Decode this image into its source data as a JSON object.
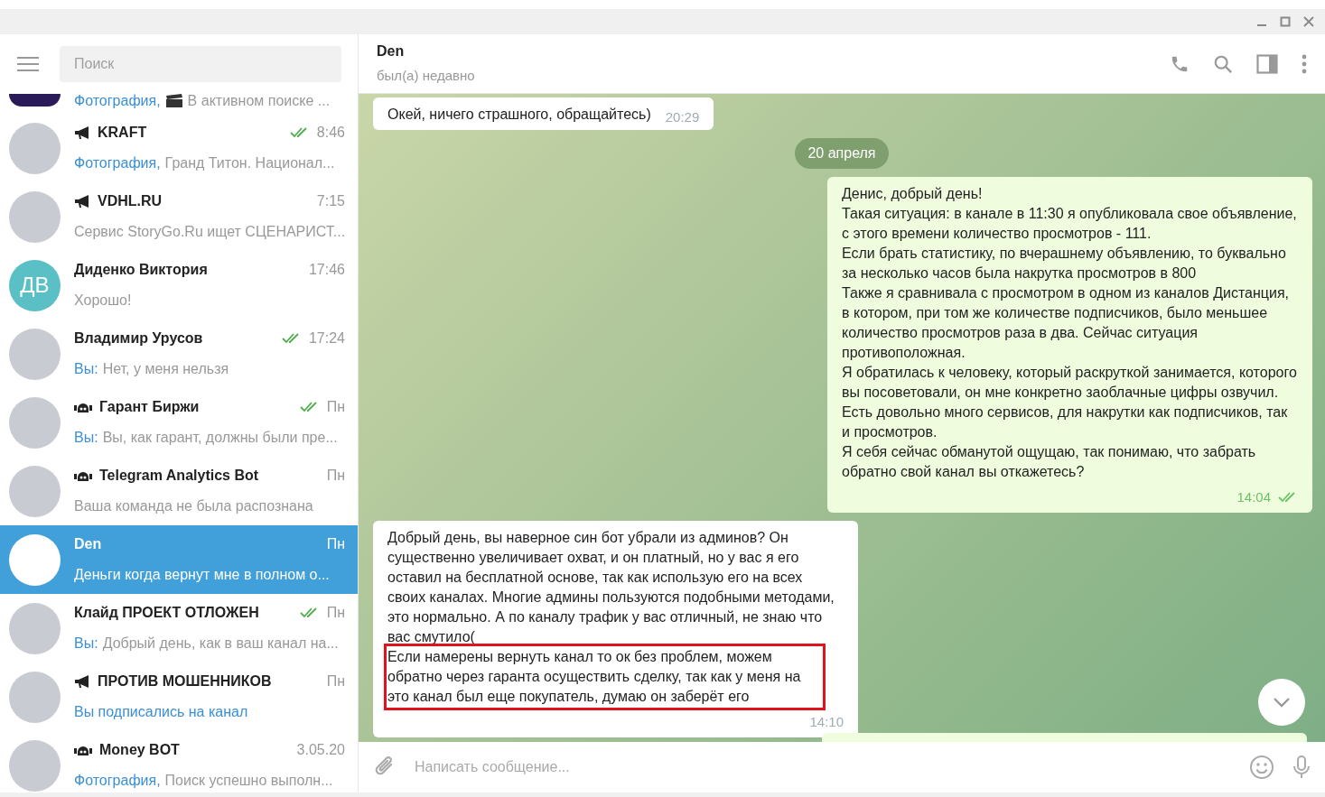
{
  "sidebar": {
    "search": {
      "placeholder": "Поиск"
    },
    "chats": [
      {
        "kind": "partial",
        "read": false,
        "highlight": "Фотография,",
        "video_icon": true,
        "preview": "В активном поиске ...",
        "selected": false
      },
      {
        "name": "KRAFT",
        "kind": "channel",
        "time": "8:46",
        "read": true,
        "highlight": "Фотография,",
        "video_icon": false,
        "preview": "Гранд Титон. Национал...",
        "selected": false
      },
      {
        "name": "VDHL.RU",
        "kind": "channel",
        "time": "7:15",
        "read": false,
        "video_icon": false,
        "preview": "Сервис StoryGo.Ru ищет СЦЕНАРИСТ...",
        "selected": false
      },
      {
        "name": "Диденко Виктория",
        "kind": "user",
        "avatar": {
          "initials": "ДВ",
          "color": "#5ac0c5"
        },
        "time": "17:46",
        "read": false,
        "video_icon": false,
        "preview": "Хорошо!",
        "selected": false
      },
      {
        "name": "Владимир Урусов",
        "kind": "user",
        "time": "17:24",
        "read": true,
        "sender": "Вы:",
        "video_icon": false,
        "preview": "Нет, у меня нельзя",
        "selected": false
      },
      {
        "name": "Гарант Биржи",
        "kind": "bot",
        "time": "Пн",
        "read": true,
        "sender": "Вы:",
        "video_icon": false,
        "preview": "Вы, как гарант, должны были пре...",
        "selected": false
      },
      {
        "name": "Telegram Analytics Bot",
        "kind": "bot",
        "time": "Пн",
        "read": false,
        "video_icon": false,
        "preview": "Ваша команда не была распознана",
        "selected": false
      },
      {
        "name": "Den",
        "kind": "user",
        "time": "Пн",
        "read": false,
        "video_icon": false,
        "preview": "Деньги когда вернут мне в полном о...",
        "selected": true
      },
      {
        "name": "Клайд ПРОЕКТ ОТЛОЖЕН",
        "kind": "user",
        "time": "Пн",
        "read": true,
        "sender": "Вы:",
        "video_icon": false,
        "preview": "Добрый день, как в ваш канал на...",
        "selected": false
      },
      {
        "name": "ПРОТИВ МОШЕННИКОВ",
        "kind": "channel",
        "time": "Пн",
        "read": false,
        "highlight": "Вы подписались на канал",
        "video_icon": false,
        "selected": false
      },
      {
        "name": "Money BOT",
        "kind": "bot",
        "time": "3.05.20",
        "read": false,
        "highlight": "Фотография,",
        "video_icon": false,
        "preview": "Поиск успешно выполн...",
        "selected": false
      }
    ]
  },
  "chat": {
    "header": {
      "name": "Den",
      "status": "был(а) недавно"
    },
    "messages": [
      {
        "kind": "incoming",
        "paragraphs": [
          {
            "text": "Окей, ничего страшного, обращайтесь)",
            "highlighted": false
          }
        ],
        "time": "20:29",
        "read": false
      },
      {
        "kind": "date",
        "text": "20 апреля"
      },
      {
        "kind": "outgoing",
        "paragraphs": [
          {
            "text": "Денис, добрый день!",
            "highlighted": false
          },
          {
            "text": "Такая ситуация: в канале в 11:30 я опубликовала свое объявление, с этого времени количество просмотров - 111.",
            "highlighted": false
          },
          {
            "text": "Если брать статистику, по вчерашнему объявлению, то буквально за несколько часов была накрутка просмотров в 800",
            "highlighted": false
          },
          {
            "text": "Также я сравнивала с просмотром в одном из каналов Дистанция, в котором, при том же количестве подписчиков, было меньшее количество просмотров раза в два. Сейчас ситуация противоположная.",
            "highlighted": false
          },
          {
            "text": "Я обратилась к человеку, который раскруткой занимается, которого вы посоветовали, он мне конкретно заоблачные цифры озвучил.",
            "highlighted": false
          },
          {
            "text": "Есть довольно много сервисов, для накрутки как подписчиков, так и просмотров.",
            "highlighted": false
          },
          {
            "text": "Я себя сейчас обманутой ощущаю, так понимаю, что забрать обратно свой канал вы откажетесь?",
            "highlighted": false
          }
        ],
        "time": "14:04",
        "read": true
      },
      {
        "kind": "incoming",
        "paragraphs": [
          {
            "text": "Добрый день, вы наверное син бот убрали из админов? Он существенно увеличивает охват, и он платный, но у вас я его оставил на бесплатной основе, так как использую его на всех своих каналах. Многие админы пользуются подобными методами, это нормально. А по каналу трафик у вас отличный, не знаю что вас смутило(",
            "highlighted": false
          },
          {
            "text": "Если намерены вернуть канал то ок без проблем, можем обратно через гаранта осуществить сделку, так как у меня на это канал был еще покупатель, думаю он заберёт его",
            "highlighted": true
          }
        ],
        "time": "14:10",
        "read": false
      }
    ],
    "composer": {
      "placeholder": "Написать сообщение..."
    }
  }
}
